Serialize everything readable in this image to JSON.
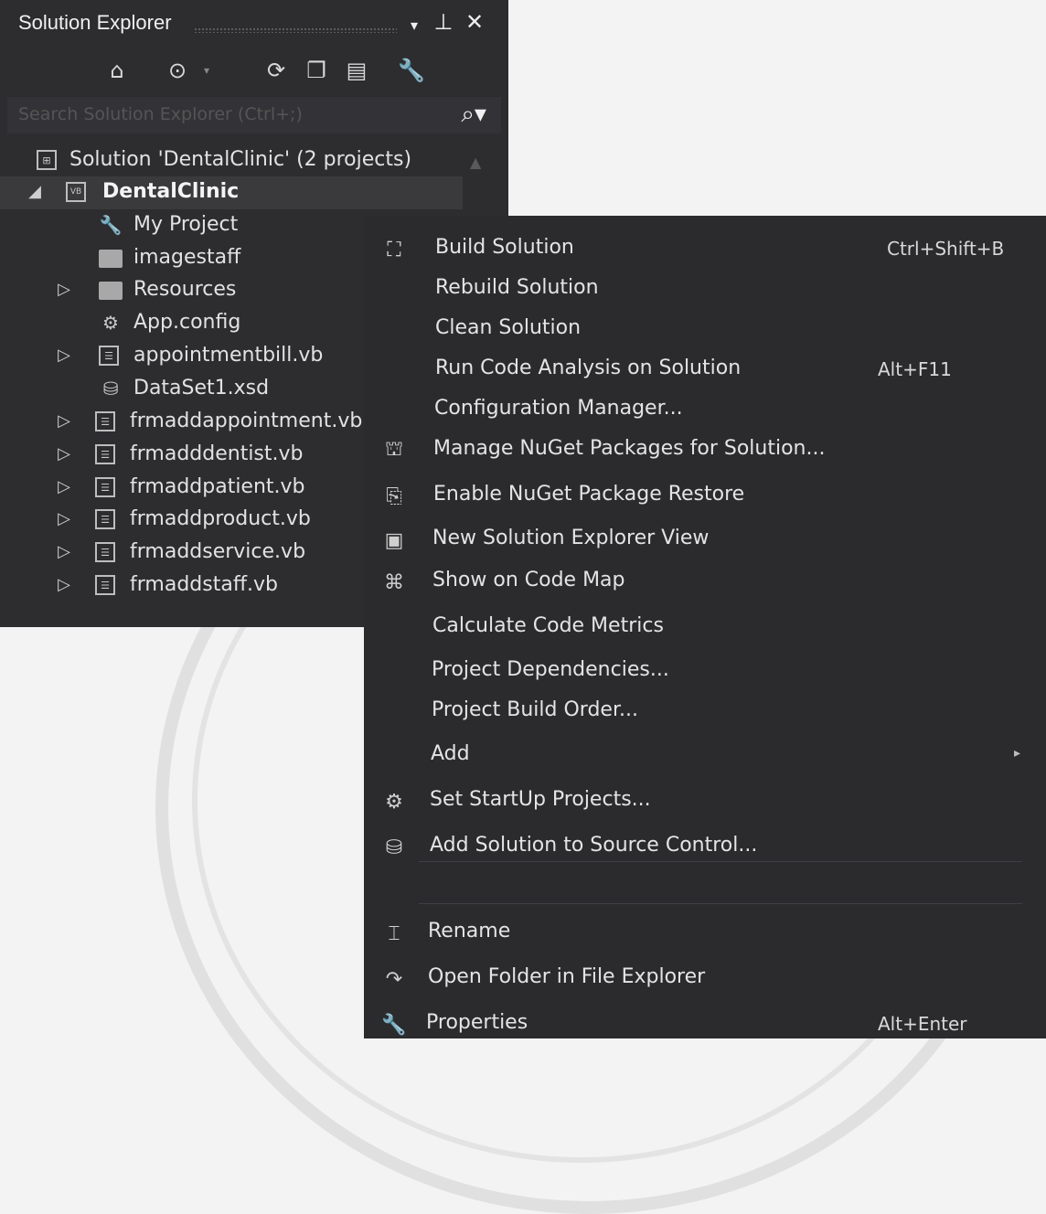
{
  "solution_explorer": {
    "title": "Solution Explorer",
    "title_controls": [
      "▾",
      "⊥",
      "✕"
    ],
    "toolbar_icons": [
      "home-icon",
      "history-icon",
      "sync-icon",
      "collapse-all-icon",
      "show-all-files-icon",
      "properties-wrench-icon"
    ],
    "search_placeholder": "Search Solution Explorer (Ctrl+;)",
    "solution_label": "Solution 'DentalClinic' (2 projects)",
    "project_label": "DentalClinic",
    "items": [
      {
        "label": "My Project",
        "icon": "wrench-icon",
        "expandable": false
      },
      {
        "label": "imagestaff",
        "icon": "folder-icon",
        "expandable": false
      },
      {
        "label": "Resources",
        "icon": "folder-icon",
        "expandable": true
      },
      {
        "label": "App.config",
        "icon": "config-icon",
        "expandable": false
      },
      {
        "label": "appointmentbill.vb",
        "icon": "form-file-icon",
        "expandable": true
      },
      {
        "label": "DataSet1.xsd",
        "icon": "dataset-icon",
        "expandable": false
      },
      {
        "label": "frmaddappointment.vb",
        "icon": "form-file-icon",
        "expandable": true
      },
      {
        "label": "frmadddentist.vb",
        "icon": "form-file-icon",
        "expandable": true
      },
      {
        "label": "frmaddpatient.vb",
        "icon": "form-file-icon",
        "expandable": true
      },
      {
        "label": "frmaddproduct.vb",
        "icon": "form-file-icon",
        "expandable": true
      },
      {
        "label": "frmaddservice.vb",
        "icon": "form-file-icon",
        "expandable": true
      },
      {
        "label": "frmaddstaff.vb",
        "icon": "form-file-icon",
        "expandable": true
      }
    ]
  },
  "context_menu": {
    "items": [
      {
        "label": "Build Solution",
        "shortcut": "Ctrl+Shift+B",
        "icon": "build-icon"
      },
      {
        "label": "Rebuild Solution",
        "shortcut": "",
        "icon": ""
      },
      {
        "label": "Clean Solution",
        "shortcut": "",
        "icon": ""
      },
      {
        "label": "Run Code Analysis on Solution",
        "shortcut": "Alt+F11",
        "icon": ""
      },
      {
        "label": "Configuration Manager...",
        "shortcut": "",
        "icon": ""
      },
      {
        "label": "Manage NuGet Packages for Solution...",
        "shortcut": "",
        "icon": "nuget-icon"
      },
      {
        "label": "Enable NuGet Package Restore",
        "shortcut": "",
        "icon": "package-restore-icon"
      },
      {
        "label": "New Solution Explorer View",
        "shortcut": "",
        "icon": "new-view-icon"
      },
      {
        "label": "Show on Code Map",
        "shortcut": "",
        "icon": "code-map-icon"
      },
      {
        "label": "Calculate Code Metrics",
        "shortcut": "",
        "icon": ""
      },
      {
        "label": "Project Dependencies...",
        "shortcut": "",
        "icon": ""
      },
      {
        "label": "Project Build Order...",
        "shortcut": "",
        "icon": ""
      },
      {
        "label": "Add",
        "shortcut": "",
        "icon": "",
        "submenu": true
      },
      {
        "label": "Set StartUp Projects...",
        "shortcut": "",
        "icon": "gear-icon"
      },
      {
        "label": "Add Solution to Source Control...",
        "shortcut": "",
        "icon": "source-control-icon"
      },
      {
        "label": "Rename",
        "shortcut": "",
        "icon": "rename-icon"
      },
      {
        "label": "Open Folder in File Explorer",
        "shortcut": "",
        "icon": "open-folder-icon"
      },
      {
        "label": "Properties",
        "shortcut": "Alt+Enter",
        "icon": "wrench-icon"
      }
    ]
  }
}
